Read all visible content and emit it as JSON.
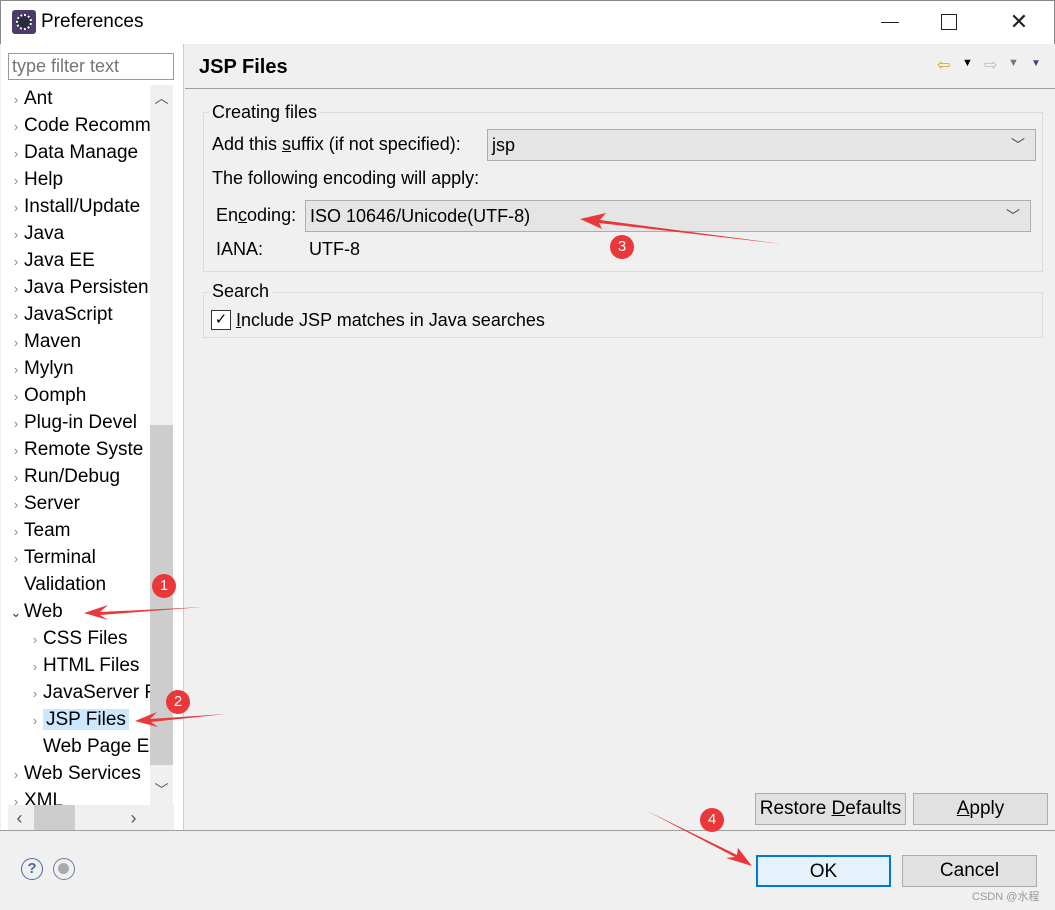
{
  "window": {
    "title": "Preferences",
    "maximize": "☐",
    "close": "✕"
  },
  "filter": {
    "placeholder": "type filter text"
  },
  "tree": [
    {
      "label": "Ant",
      "level": 0,
      "expander": "›"
    },
    {
      "label": "Code Recomm",
      "level": 0,
      "expander": "›"
    },
    {
      "label": "Data Manage",
      "level": 0,
      "expander": "›"
    },
    {
      "label": "Help",
      "level": 0,
      "expander": "›"
    },
    {
      "label": "Install/Update",
      "level": 0,
      "expander": "›"
    },
    {
      "label": "Java",
      "level": 0,
      "expander": "›"
    },
    {
      "label": "Java EE",
      "level": 0,
      "expander": "›"
    },
    {
      "label": "Java Persisten",
      "level": 0,
      "expander": "›"
    },
    {
      "label": "JavaScript",
      "level": 0,
      "expander": "›"
    },
    {
      "label": "Maven",
      "level": 0,
      "expander": "›"
    },
    {
      "label": "Mylyn",
      "level": 0,
      "expander": "›"
    },
    {
      "label": "Oomph",
      "level": 0,
      "expander": "›"
    },
    {
      "label": "Plug-in Devel",
      "level": 0,
      "expander": "›"
    },
    {
      "label": "Remote Syste",
      "level": 0,
      "expander": "›"
    },
    {
      "label": "Run/Debug",
      "level": 0,
      "expander": "›"
    },
    {
      "label": "Server",
      "level": 0,
      "expander": "›"
    },
    {
      "label": "Team",
      "level": 0,
      "expander": "›"
    },
    {
      "label": "Terminal",
      "level": 0,
      "expander": "›"
    },
    {
      "label": "Validation",
      "level": 0,
      "expander": ""
    },
    {
      "label": "Web",
      "level": 0,
      "expander": "⌄"
    },
    {
      "label": "CSS Files",
      "level": 1,
      "expander": "›"
    },
    {
      "label": "HTML Files",
      "level": 1,
      "expander": "›"
    },
    {
      "label": "JavaServer F",
      "level": 1,
      "expander": "›"
    },
    {
      "label": "JSP Files",
      "level": 1,
      "expander": "›",
      "selected": true
    },
    {
      "label": "Web Page E",
      "level": 1,
      "expander": ""
    },
    {
      "label": "Web Services",
      "level": 0,
      "expander": "›"
    },
    {
      "label": "XML",
      "level": 0,
      "expander": "›"
    }
  ],
  "page": {
    "title": "JSP Files",
    "creating": {
      "legend": "Creating files",
      "suffix_label": "Add this suffix (if not specified):",
      "suffix_value": "jsp",
      "encoding_note": "The following encoding will apply:",
      "encoding_label": "Encoding:",
      "encoding_value": "ISO 10646/Unicode(UTF-8)",
      "iana_label": "IANA:",
      "iana_value": "UTF-8"
    },
    "search": {
      "legend": "Search",
      "include_label": "Include JSP matches in Java searches",
      "include_checked": true
    },
    "restore_defaults": "Restore Defaults",
    "apply": "Apply"
  },
  "footer": {
    "ok": "OK",
    "cancel": "Cancel",
    "watermark": "CSDN @水程"
  },
  "annotations": {
    "color": "#e9373a",
    "markers": [
      "1",
      "2",
      "3",
      "4"
    ]
  }
}
